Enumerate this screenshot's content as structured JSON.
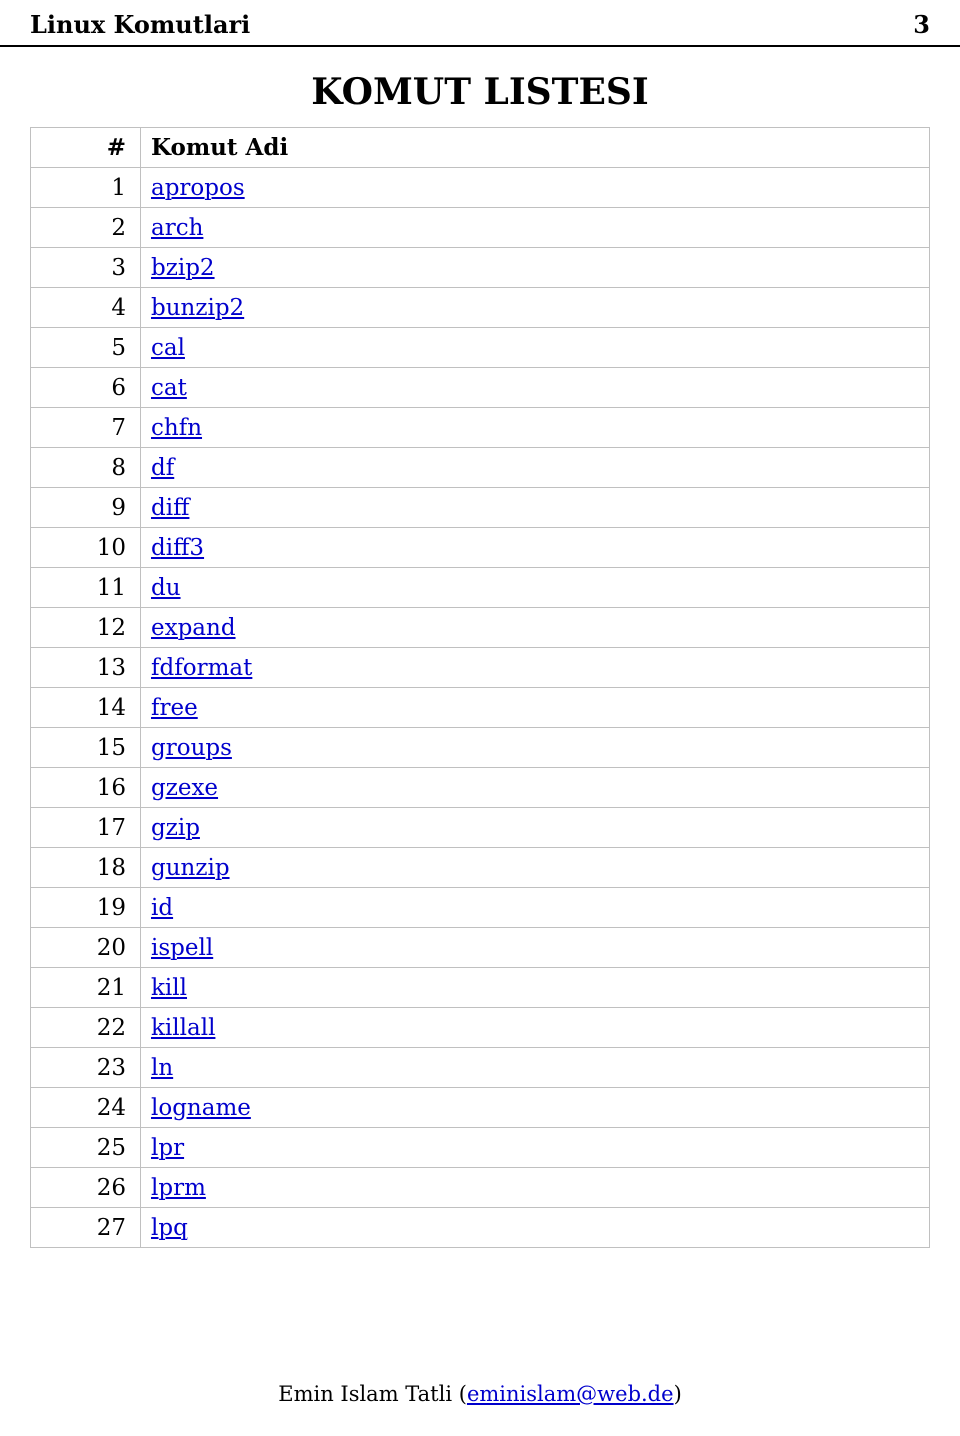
{
  "header": {
    "title": "Linux Komutlari",
    "page_number": "3"
  },
  "main_title": "KOMUT LISTESI",
  "table": {
    "columns": [
      "#",
      "Komut Adi"
    ],
    "rows": [
      {
        "num": "1",
        "name": "apropos"
      },
      {
        "num": "2",
        "name": "arch"
      },
      {
        "num": "3",
        "name": "bzip2"
      },
      {
        "num": "4",
        "name": "bunzip2"
      },
      {
        "num": "5",
        "name": "cal"
      },
      {
        "num": "6",
        "name": "cat"
      },
      {
        "num": "7",
        "name": "chfn"
      },
      {
        "num": "8",
        "name": "df"
      },
      {
        "num": "9",
        "name": "diff"
      },
      {
        "num": "10",
        "name": "diff3"
      },
      {
        "num": "11",
        "name": "du"
      },
      {
        "num": "12",
        "name": "expand"
      },
      {
        "num": "13",
        "name": "fdformat"
      },
      {
        "num": "14",
        "name": "free"
      },
      {
        "num": "15",
        "name": "groups"
      },
      {
        "num": "16",
        "name": "gzexe"
      },
      {
        "num": "17",
        "name": "gzip"
      },
      {
        "num": "18",
        "name": "gunzip"
      },
      {
        "num": "19",
        "name": "id"
      },
      {
        "num": "20",
        "name": "ispell"
      },
      {
        "num": "21",
        "name": "kill"
      },
      {
        "num": "22",
        "name": "killall"
      },
      {
        "num": "23",
        "name": "ln"
      },
      {
        "num": "24",
        "name": "logname"
      },
      {
        "num": "25",
        "name": "lpr"
      },
      {
        "num": "26",
        "name": "lprm"
      },
      {
        "num": "27",
        "name": "lpq"
      }
    ]
  },
  "footer": {
    "author": "Emin Islam Tatli",
    "email": "eminislam@web.de"
  }
}
